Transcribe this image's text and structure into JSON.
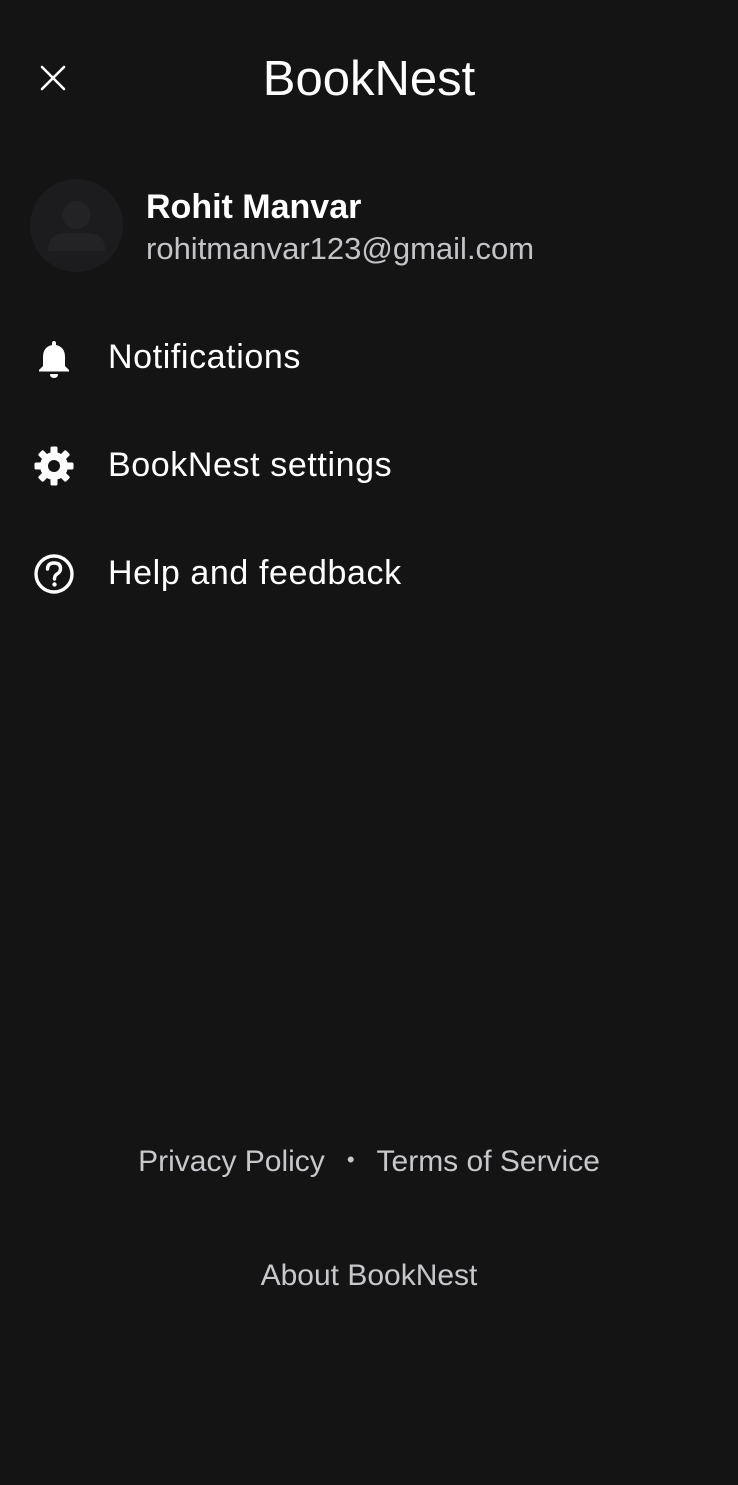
{
  "header": {
    "title": "BookNest",
    "close_icon": "close-icon"
  },
  "account": {
    "name": "Rohit Manvar",
    "email": "rohitmanvar123@gmail.com",
    "avatar_icon": "default-avatar-icon"
  },
  "menu": {
    "items": [
      {
        "label": "Notifications",
        "icon": "bell-icon"
      },
      {
        "label": "BookNest settings",
        "icon": "gear-icon"
      },
      {
        "label": "Help and feedback",
        "icon": "help-circle-icon"
      }
    ]
  },
  "footer": {
    "privacy_label": "Privacy Policy",
    "separator": "•",
    "terms_label": "Terms of Service",
    "about_label": "About BookNest"
  },
  "colors": {
    "background": "#141415",
    "primary_text": "#ffffff",
    "secondary_text": "#c4c4c8"
  }
}
